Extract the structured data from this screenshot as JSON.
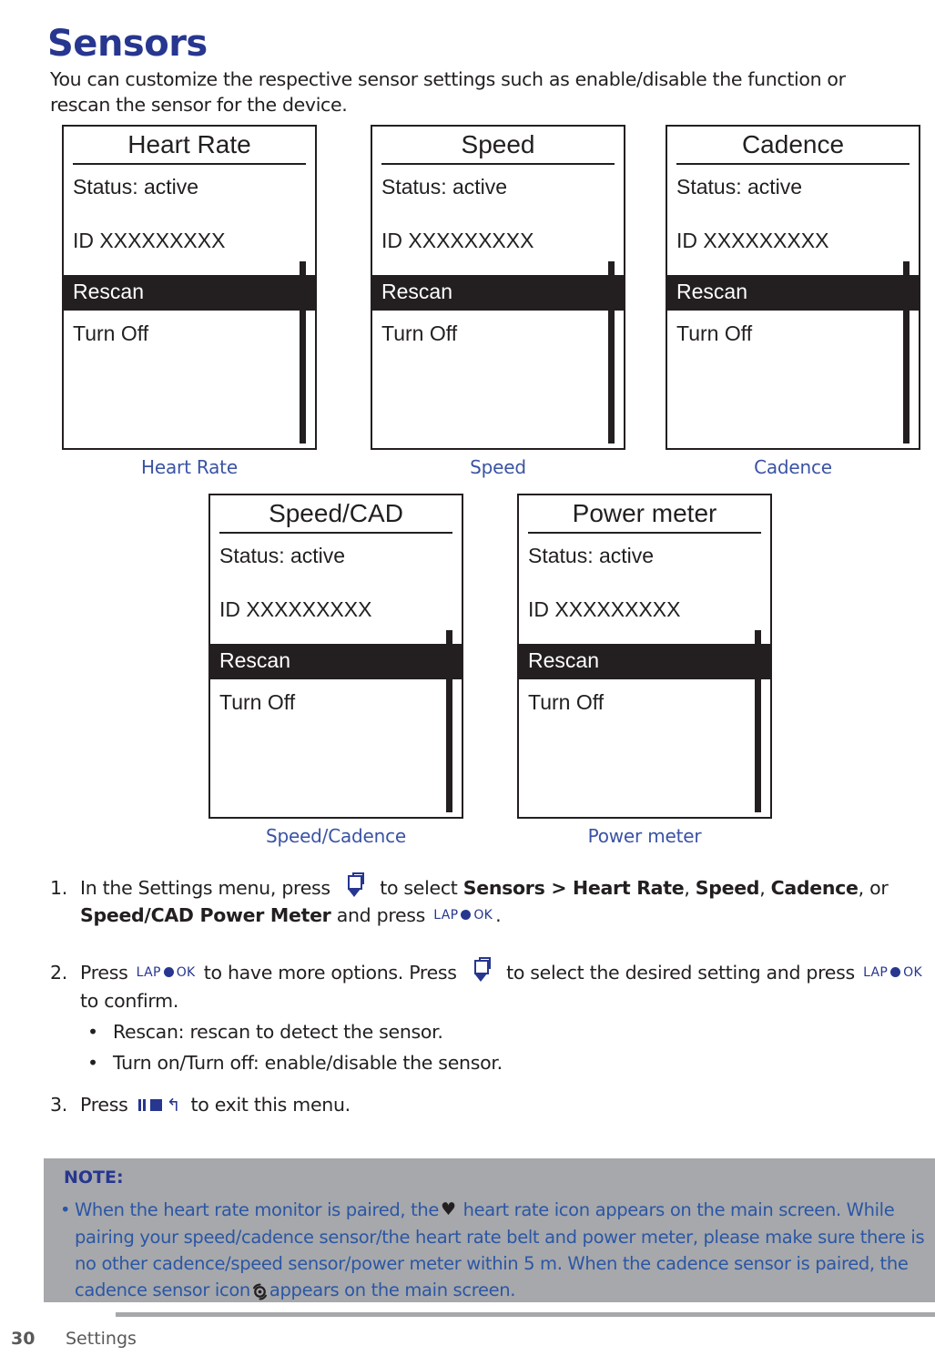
{
  "heading": "Sensors",
  "intro": "You can customize the respective sensor settings such as enable/disable the function or rescan the sensor for the device.",
  "screens": [
    {
      "title": "Heart Rate",
      "status": "Status: active",
      "id": "ID XXXXXXXXX",
      "highlighted_item": "Rescan",
      "item": "Turn Off",
      "caption": "Heart Rate"
    },
    {
      "title": "Speed",
      "status": "Status: active",
      "id": "ID XXXXXXXXX",
      "highlighted_item": "Rescan",
      "item": "Turn Off",
      "caption": "Speed"
    },
    {
      "title": "Cadence",
      "status": "Status: active",
      "id": "ID XXXXXXXXX",
      "highlighted_item": "Rescan",
      "item": "Turn Off",
      "caption": "Cadence"
    },
    {
      "title": "Speed/CAD",
      "status": "Status: active",
      "id": "ID XXXXXXXXX",
      "highlighted_item": "Rescan",
      "item": "Turn Off",
      "caption": "Speed/Cadence"
    },
    {
      "title": "Power meter",
      "status": "Status: active",
      "id": "ID XXXXXXXXX",
      "highlighted_item": "Rescan",
      "item": "Turn Off",
      "caption": "Power meter"
    }
  ],
  "steps": {
    "one": {
      "num": "1.",
      "t1": "In the Settings menu, press",
      "t2": "to select",
      "b1": "Sensors > Heart Rate",
      "c1": ",",
      "b2": "Speed",
      "c2": ",",
      "b3": "Cadence",
      "c3": ", or",
      "b4": "Speed/CAD Power Meter",
      "t3": "and press",
      "t4": "."
    },
    "two": {
      "num": "2.",
      "t1": "Press",
      "t2": "to have more options.  Press",
      "t3": "to select the desired setting and press",
      "t4": "to confirm.",
      "bullets": [
        "Rescan: rescan to detect the sensor.",
        "Turn on/Turn off: enable/disable the sensor."
      ],
      "bullet_dot": "•"
    },
    "three": {
      "num": "3.",
      "t1": "Press",
      "t2": "to exit this menu."
    }
  },
  "icons": {
    "page_down": "page-down-key-icon",
    "lap_label": "LAP",
    "ok_label": "OK",
    "lap_ok": "lap-ok-key-icon",
    "exit": "pause-stop-back-key-icon",
    "back_glyph": "↰",
    "heart": "♥",
    "cadence_sensor": "cadence-sensor-icon"
  },
  "note": {
    "title": "NOTE:",
    "bullet_dot": "•",
    "part1": "When the heart rate monitor is paired, the",
    "part2": "heart rate icon appears on the main screen. While pairing your speed/cadence sensor/the heart rate belt and power meter, please make sure there is no other cadence/speed sensor/power meter within 5 m. When the cadence sensor is paired, the cadence sensor icon",
    "part3": "appears on the main screen."
  },
  "footer": {
    "page_number": "30",
    "section": "Settings"
  },
  "colors": {
    "heading_blue": "#27368f",
    "caption_blue": "#3a53a4",
    "note_bg": "#a6a8ab",
    "note_text": "#2b56a5",
    "device_black": "#231f20",
    "footer_gray": "#58595b"
  }
}
